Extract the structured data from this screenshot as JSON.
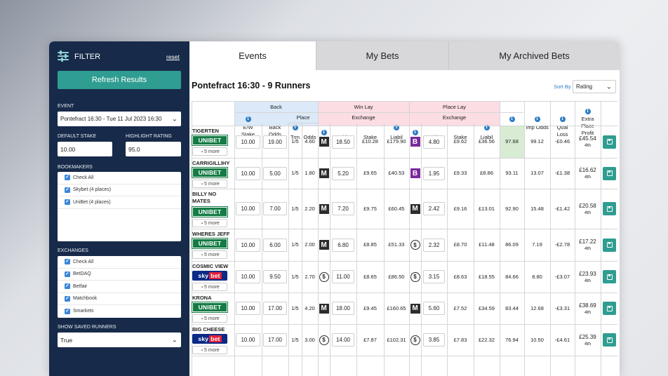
{
  "sidebar": {
    "title": "FILTER",
    "reset": "reset",
    "refresh": "Refresh Results",
    "event_label": "EVENT",
    "event_value": "Pontefract 16:30 - Tue 11 Jul 2023 16:30",
    "stake_label": "DEFAULT STAKE",
    "stake_value": "10.00",
    "highlight_label": "HIGHLIGHT RATING",
    "highlight_value": "95.0",
    "bookmakers_label": "BOOKMAKERS",
    "bookmakers": [
      "Check All",
      "Skybet (4 places)",
      "UniBet (4 places)"
    ],
    "exchanges_label": "EXCHANGES",
    "exchanges": [
      "Check All",
      "BetDAQ",
      "Betfair",
      "Matchbook",
      "Smarkets"
    ],
    "saved_label": "SHOW SAVED RUNNERS",
    "saved_value": "True"
  },
  "tabs": [
    "Events",
    "My Bets",
    "My Archived Bets"
  ],
  "active_tab": 0,
  "race_title": "Pontefract 16:30 - 9 Runners",
  "sort": {
    "label": "Sort By",
    "value": "Rating"
  },
  "headers": {
    "bet": "Bet",
    "back": "Back",
    "place": "Place",
    "win_lay": "Win Lay",
    "place_lay": "Place Lay",
    "exchange": "Exchange",
    "ew_stake": "E/W Stake",
    "back_odds": "Back Odds",
    "trm": "Trm",
    "odds": "Odds",
    "stake": "Stake",
    "liabil": "Liabil",
    "rate": "Rate %",
    "imp_odds": "Imp Odds",
    "qual_loss": "Qual Loss",
    "extra_place_profit": "Extra Place Profit"
  },
  "more_label": "5 more",
  "colors": {
    "sidebar": "#172a49",
    "teal": "#2f9d91",
    "back": "#dbe9f8",
    "lay": "#fbdde3",
    "highlight": "#d8ecd4"
  },
  "runners": [
    {
      "name": "TIGERTEN",
      "bookie": "unibet",
      "ew_stake": "10.00",
      "back_odds": "19.00",
      "term": "1/5",
      "place_odds": "4.60",
      "win_ex": "M",
      "win_odds": "18.50",
      "win_stake": "£10.28",
      "win_liab": "£179.90",
      "place_ex": "B",
      "place_lay_odds": "4.80",
      "place_stake": "£9.62",
      "place_liab": "£36.56",
      "rate": "97.68",
      "imp_odds": "99.12",
      "qual_loss": "-£0.46",
      "profit": "£45.54",
      "places": "4th"
    },
    {
      "name": "CARRIGILLIHY",
      "bookie": "unibet",
      "ew_stake": "10.00",
      "back_odds": "5.00",
      "term": "1/5",
      "place_odds": "1.80",
      "win_ex": "M",
      "win_odds": "5.20",
      "win_stake": "£9.65",
      "win_liab": "£40.53",
      "place_ex": "B",
      "place_lay_odds": "1.95",
      "place_stake": "£9.33",
      "place_liab": "£8.86",
      "rate": "93.11",
      "imp_odds": "13.07",
      "qual_loss": "-£1.38",
      "profit": "£16.62",
      "places": "4th"
    },
    {
      "name": "BILLY NO MATES",
      "bookie": "unibet",
      "ew_stake": "10.00",
      "back_odds": "7.00",
      "term": "1/5",
      "place_odds": "2.20",
      "win_ex": "M",
      "win_odds": "7.20",
      "win_stake": "£9.75",
      "win_liab": "£60.45",
      "place_ex": "M",
      "place_lay_odds": "2.42",
      "place_stake": "£9.16",
      "place_liab": "£13.01",
      "rate": "92.90",
      "imp_odds": "15.48",
      "qual_loss": "-£1.42",
      "profit": "£20.58",
      "places": "4th"
    },
    {
      "name": "WHERES JEFF",
      "bookie": "unibet",
      "ew_stake": "10.00",
      "back_odds": "6.00",
      "term": "1/5",
      "place_odds": "2.00",
      "win_ex": "M",
      "win_odds": "6.80",
      "win_stake": "£8.85",
      "win_liab": "£51.33",
      "place_ex": "S",
      "place_lay_odds": "2.32",
      "place_stake": "£8.70",
      "place_liab": "£11.48",
      "rate": "86.09",
      "imp_odds": "7.19",
      "qual_loss": "-£2.78",
      "profit": "£17.22",
      "places": "4th"
    },
    {
      "name": "COSMIC VIEW",
      "bookie": "skybet",
      "ew_stake": "10.00",
      "back_odds": "9.50",
      "term": "1/5",
      "place_odds": "2.70",
      "win_ex": "S",
      "win_odds": "11.00",
      "win_stake": "£8.65",
      "win_liab": "£86.50",
      "place_ex": "S",
      "place_lay_odds": "3.15",
      "place_stake": "£8.63",
      "place_liab": "£18.55",
      "rate": "84.66",
      "imp_odds": "8.80",
      "qual_loss": "-£3.07",
      "profit": "£23.93",
      "places": "4th"
    },
    {
      "name": "KRONA",
      "bookie": "unibet",
      "ew_stake": "10.00",
      "back_odds": "17.00",
      "term": "1/5",
      "place_odds": "4.20",
      "win_ex": "M",
      "win_odds": "18.00",
      "win_stake": "£9.45",
      "win_liab": "£160.65",
      "place_ex": "M",
      "place_lay_odds": "5.60",
      "place_stake": "£7.52",
      "place_liab": "£34.59",
      "rate": "83.44",
      "imp_odds": "12.68",
      "qual_loss": "-£3.31",
      "profit": "£38.69",
      "places": "4th"
    },
    {
      "name": "BIG CHEESE",
      "bookie": "skybet",
      "ew_stake": "10.00",
      "back_odds": "17.00",
      "term": "1/5",
      "place_odds": "3.00",
      "win_ex": "S",
      "win_odds": "14.00",
      "win_stake": "£7.87",
      "win_liab": "£102.31",
      "place_ex": "S",
      "place_lay_odds": "3.85",
      "place_stake": "£7.83",
      "place_liab": "£22.32",
      "rate": "76.94",
      "imp_odds": "10.50",
      "qual_loss": "-£4.61",
      "profit": "£25.39",
      "places": "4th"
    }
  ]
}
